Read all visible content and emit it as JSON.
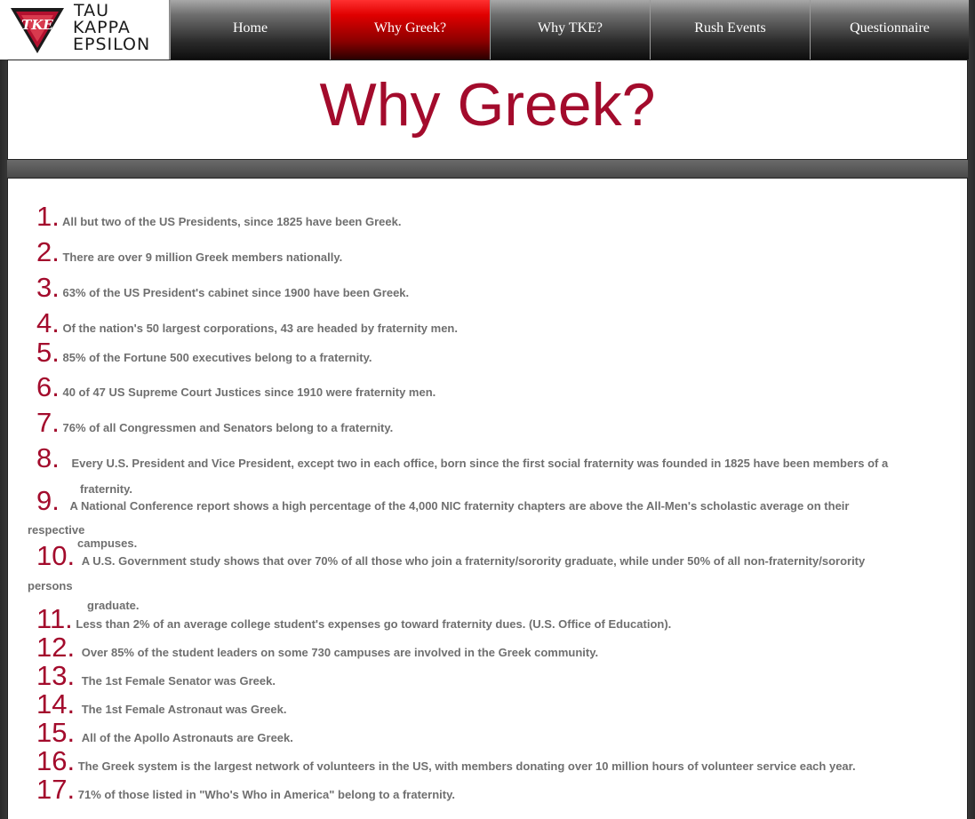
{
  "logo": {
    "mark_text": "TKE",
    "lines": [
      "TAU",
      "KAPPA",
      "EPSILON"
    ]
  },
  "nav": [
    {
      "label": "Home",
      "active": false
    },
    {
      "label": "Why Greek?",
      "active": true
    },
    {
      "label": "Why TKE?",
      "active": false
    },
    {
      "label": "Rush Events",
      "active": false
    },
    {
      "label": "Questionnaire",
      "active": false
    }
  ],
  "page_title": "Why Greek?",
  "colors": {
    "accent": "#a30b2c",
    "active_tab": "#e00000",
    "body_text": "#6f6f6f"
  },
  "facts": [
    {
      "num": "1.",
      "text": "All but two of the US Presidents, since 1825 have been Greek."
    },
    {
      "num": "2.",
      "text": "There are over 9 million Greek members nationally."
    },
    {
      "num": "3.",
      "text": "63% of the US President's cabinet since 1900 have been Greek."
    },
    {
      "num": "4.",
      "text": "Of the nation's 50 largest corporations, 43 are headed by fraternity men."
    },
    {
      "num": "5.",
      "text": "85% of the Fortune 500 executives belong to a fraternity."
    },
    {
      "num": "6.",
      "text": "40 of 47 US Supreme Court Justices since 1910 were fraternity men."
    },
    {
      "num": "7.",
      "text": "76% of all Congressmen and Senators belong to a fraternity."
    },
    {
      "num": "8.",
      "text": "Every U.S. President and Vice President, except two in each office, born since the first social fraternity was founded in 1825 have been   members of a",
      "cont": "fraternity."
    },
    {
      "num": "9.",
      "text": "A National Conference report shows a high percentage of the 4,000 NIC fraternity chapters are above the All-Men's scholastic average on their",
      "cont_a": "respective",
      "cont": "campuses."
    },
    {
      "num": "10.",
      "text": "A U.S. Government study shows that over 70% of all those who join a fraternity/sorority graduate, while under 50% of all non-fraternity/sorority",
      "cont_a": "persons",
      "cont": "graduate."
    },
    {
      "num": "11.",
      "text": "Less than 2% of an average college student's expenses go toward fraternity dues.  (U.S. Office of Education)."
    },
    {
      "num": "12.",
      "text": "Over 85% of the student leaders on some 730 campuses are involved in the Greek community."
    },
    {
      "num": "13.",
      "text": "The 1st Female Senator was Greek."
    },
    {
      "num": "14.",
      "text": "The 1st Female Astronaut was Greek."
    },
    {
      "num": "15.",
      "text": "All of the Apollo Astronauts are Greek."
    },
    {
      "num": "16.",
      "text": "The Greek system is the largest network of volunteers in the US, with members donating over 10 million hours of volunteer service each year."
    },
    {
      "num": "17.",
      "text": "71% of those listed in \"Who's Who in America\" belong to a fraternity."
    }
  ]
}
